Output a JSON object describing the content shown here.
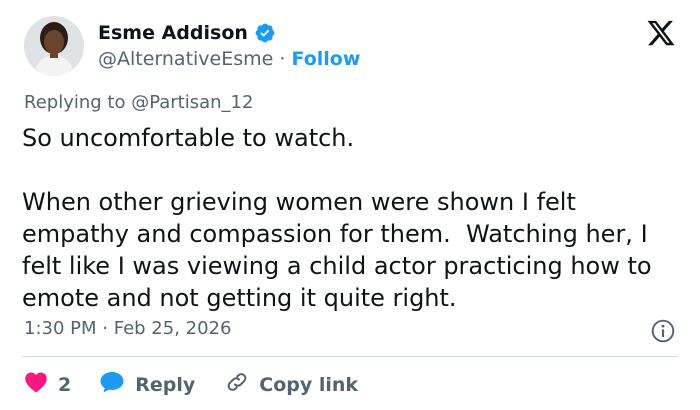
{
  "author": {
    "display_name": "Esme Addison",
    "handle": "@AlternativeEsme",
    "separator": "·",
    "follow_label": "Follow"
  },
  "reply_context": {
    "prefix": "Replying to ",
    "mention": "@Partisan_12"
  },
  "tweet": {
    "text": "So uncomfortable to watch.\n\nWhen other grieving women were shown I felt empathy and compassion for them.  Watching her, I felt like I was viewing a child actor practicing how to emote and not getting it quite right.",
    "time": "1:30 PM",
    "separator": "·",
    "date": "Feb 25, 2026"
  },
  "actions": {
    "like_count": "2",
    "reply_label": "Reply",
    "copy_link_label": "Copy link"
  },
  "colors": {
    "accent": "#1d9bf0",
    "like": "#f91880",
    "text_primary": "#0f1419",
    "text_secondary": "#536471"
  },
  "icons": [
    "verified-badge-icon",
    "x-logo-icon",
    "info-icon",
    "heart-icon",
    "reply-bubble-icon",
    "link-icon"
  ]
}
